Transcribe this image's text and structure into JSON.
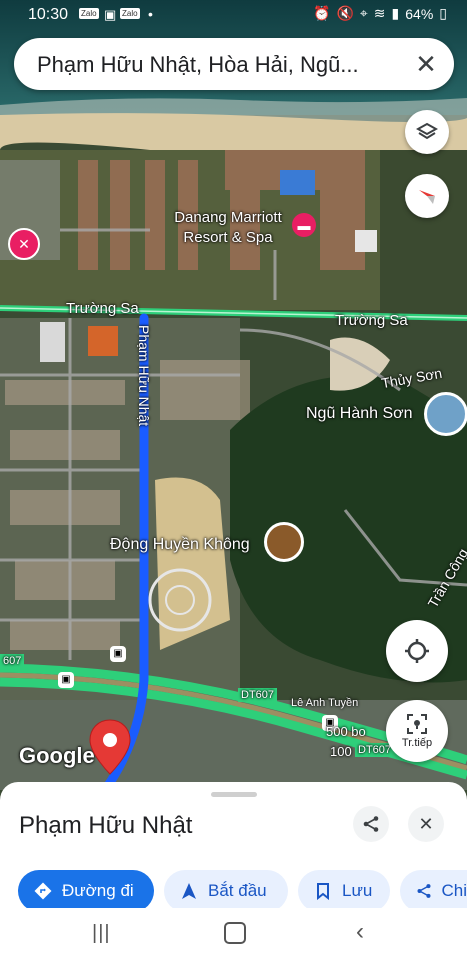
{
  "status_bar": {
    "time": "10:30",
    "notification_icons": [
      "Zalo",
      "image-icon",
      "Zalo"
    ],
    "dot": "•",
    "battery": "64%"
  },
  "search": {
    "query": "Phạm Hữu Nhật, Hòa Hải, Ngũ..."
  },
  "map_labels": {
    "marriott": "Danang Marriott Resort & Spa",
    "truong_sa_left": "Trường Sa",
    "truong_sa_right": "Trường Sa",
    "pham_huu_nhat_road": "Phạm Hữu Nhật",
    "thuy_son": "Thủy Sơn",
    "ngu_hanh_son": "Ngũ Hành Sơn",
    "dong_huyen_khong": "Động Huyền Không",
    "dt607_left": "607",
    "dt607_mid": "DT607",
    "dt607_right": "DT607",
    "le_anh_tuyen": "Lê Anh Tuyền",
    "num_500": "500 bo",
    "num_100": "100",
    "tran_cong": "Trần Công",
    "google_logo": "Google"
  },
  "map_buttons": {
    "start_label": "Tr.tiếp"
  },
  "sheet": {
    "place_name": "Phạm Hữu Nhật",
    "actions": [
      {
        "label": "Đường đi",
        "icon": "directions-icon",
        "style": "primary"
      },
      {
        "label": "Bắt đầu",
        "icon": "navigation-arrow-icon",
        "style": "secondary"
      },
      {
        "label": "Lưu",
        "icon": "bookmark-icon",
        "style": "secondary"
      },
      {
        "label": "Chi",
        "icon": "share-icon",
        "style": "secondary"
      }
    ]
  },
  "colors": {
    "route_blue": "#1a5cff",
    "highway_green": "#2ecf7a",
    "primary_button": "#1a73e8",
    "pin_red": "#e53935",
    "hotel_pink": "#e91e63"
  }
}
